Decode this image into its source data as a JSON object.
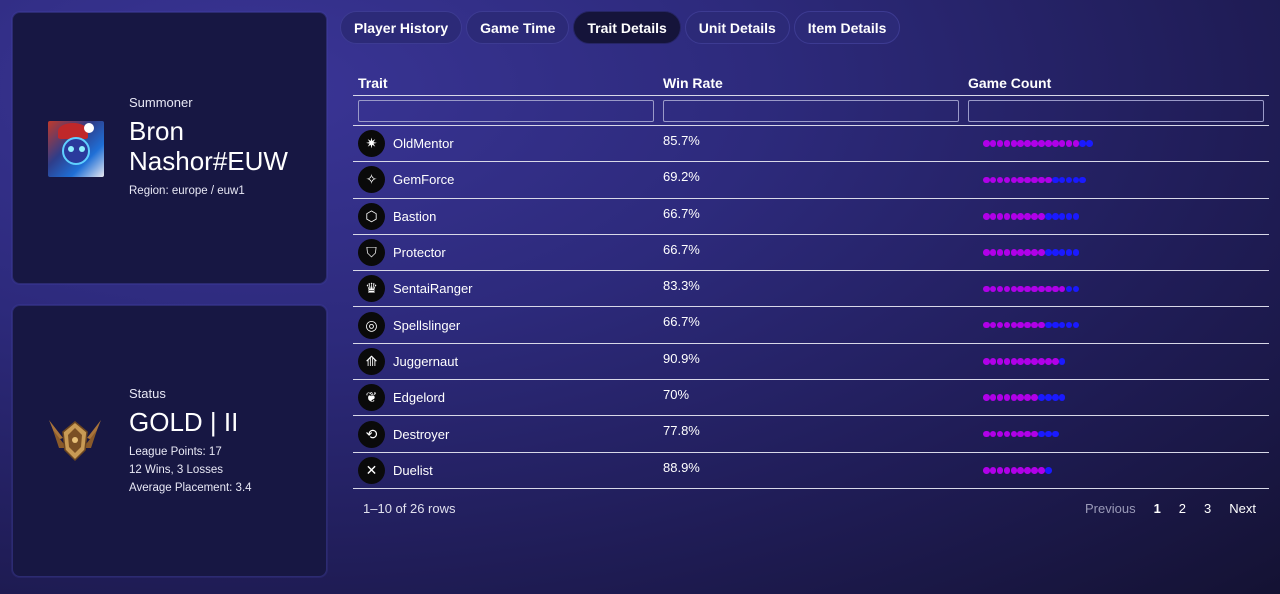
{
  "summoner": {
    "label": "Summoner",
    "name_line1": "Bron",
    "name_line2": "Nashor#EUW",
    "region": "Region: europe / euw1"
  },
  "status": {
    "label": "Status",
    "rank": "GOLD | II",
    "lp": "League Points: 17",
    "record": "12 Wins, 3 Losses",
    "avg": "Average Placement: 3.4"
  },
  "tabs": [
    "Player History",
    "Game Time",
    "Trait Details",
    "Unit Details",
    "Item Details"
  ],
  "active_tab": "Trait Details",
  "table": {
    "headers": [
      "Trait",
      "Win Rate",
      "Game Count"
    ],
    "rows": [
      {
        "trait": "OldMentor",
        "win_rate": "85.7%",
        "icon": "old-mentor-icon",
        "purple": 14,
        "blue": 2
      },
      {
        "trait": "GemForce",
        "win_rate": "69.2%",
        "icon": "gem-force-icon",
        "purple": 10,
        "blue": 5
      },
      {
        "trait": "Bastion",
        "win_rate": "66.7%",
        "icon": "bastion-icon",
        "purple": 9,
        "blue": 5
      },
      {
        "trait": "Protector",
        "win_rate": "66.7%",
        "icon": "protector-icon",
        "purple": 9,
        "blue": 5
      },
      {
        "trait": "SentaiRanger",
        "win_rate": "83.3%",
        "icon": "sentai-ranger-icon",
        "purple": 12,
        "blue": 2
      },
      {
        "trait": "Spellslinger",
        "win_rate": "66.7%",
        "icon": "spellslinger-icon",
        "purple": 9,
        "blue": 5
      },
      {
        "trait": "Juggernaut",
        "win_rate": "90.9%",
        "icon": "juggernaut-icon",
        "purple": 11,
        "blue": 1
      },
      {
        "trait": "Edgelord",
        "win_rate": "70%",
        "icon": "edgelord-icon",
        "purple": 8,
        "blue": 4
      },
      {
        "trait": "Destroyer",
        "win_rate": "77.8%",
        "icon": "destroyer-icon",
        "purple": 8,
        "blue": 3
      },
      {
        "trait": "Duelist",
        "win_rate": "88.9%",
        "icon": "duelist-icon",
        "purple": 9,
        "blue": 1
      }
    ]
  },
  "footer": {
    "rows_text": "1–10 of 26 rows",
    "prev": "Previous",
    "pages": [
      "1",
      "2",
      "3"
    ],
    "next": "Next"
  },
  "colors": {
    "win_dot": "#b000e8",
    "loss_dot": "#1a1aff"
  }
}
